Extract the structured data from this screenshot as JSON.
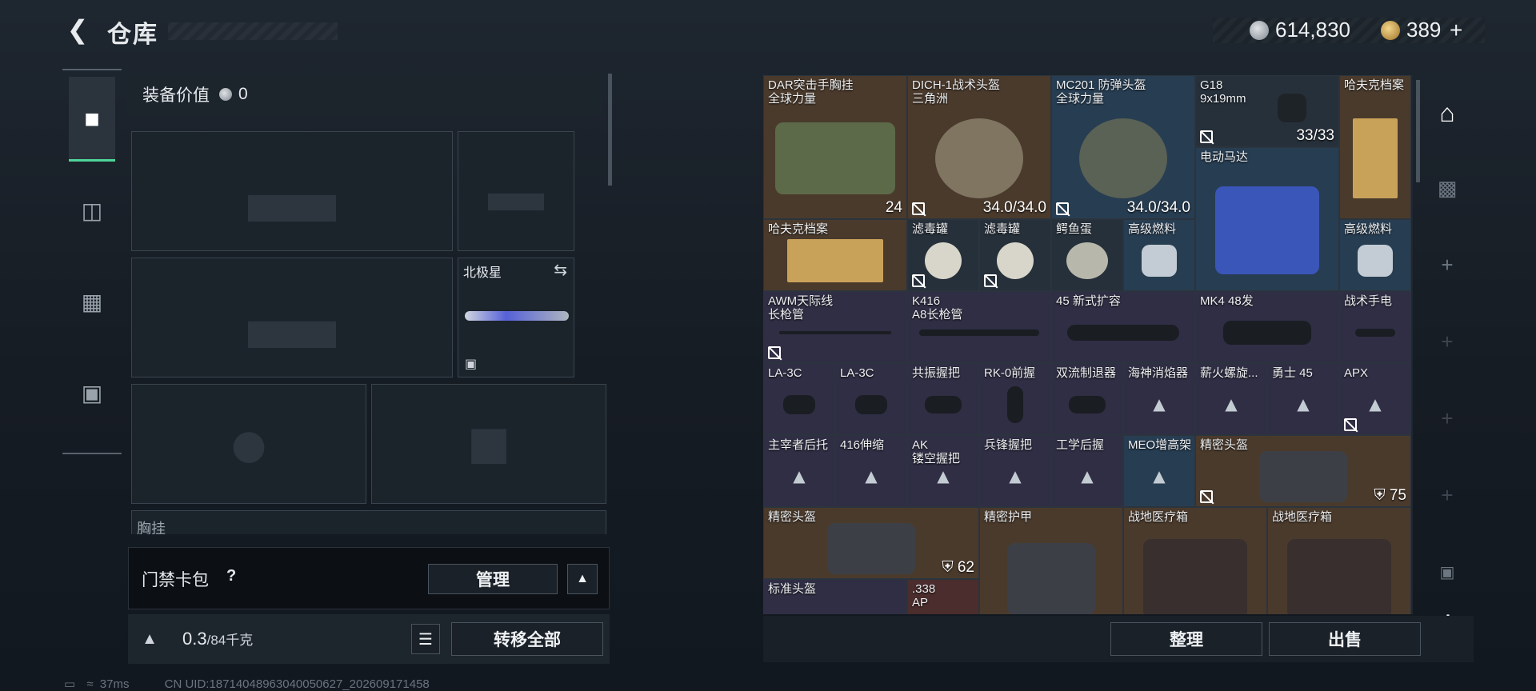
{
  "header": {
    "title": "仓库"
  },
  "currency": {
    "silver": "614,830",
    "gold": "389",
    "gold_plus": "+"
  },
  "tabs": [
    {
      "name": "weapons"
    },
    {
      "name": "backpack"
    },
    {
      "name": "chest-rig"
    },
    {
      "name": "case"
    }
  ],
  "loadout": {
    "value_label": "装备价值",
    "value": "0",
    "melee_name": "北极星",
    "chest_label": "胸挂"
  },
  "keycard": {
    "label": "门禁卡包",
    "help": "?",
    "manage": "管理"
  },
  "capacity": {
    "current": "0.3",
    "max": "/84千克",
    "transfer_all": "转移全部"
  },
  "status": {
    "ping": "37ms",
    "uid": "CN UID:18714048963040050627_202609171458"
  },
  "items": [
    {
      "name": "DAR突击手胸挂\n全球力量",
      "value": "24",
      "color": "brown"
    },
    {
      "name": "DICH-1战术头盔\n三角洲",
      "value": "34.0/34.0",
      "color": "brown"
    },
    {
      "name": "MC201 防弹头盔\n全球力量",
      "value": "34.0/34.0",
      "color": "blue"
    },
    {
      "name": "G18\n9x19mm",
      "value": "33/33",
      "color": "gray"
    },
    {
      "name": "哈夫克档案",
      "value": "",
      "color": "brown"
    },
    {
      "name": "电动马达",
      "value": "",
      "color": "blue"
    },
    {
      "name": "哈夫克档案",
      "value": "",
      "color": "brown"
    },
    {
      "name": "滤毒罐",
      "value": "",
      "color": "gray"
    },
    {
      "name": "滤毒罐",
      "value": "",
      "color": "gray"
    },
    {
      "name": "鳄鱼蛋",
      "value": "",
      "color": "gray"
    },
    {
      "name": "高级燃料",
      "value": "",
      "color": "blue"
    },
    {
      "name": "高级燃料",
      "value": "",
      "color": "blue"
    },
    {
      "name": "AWM天际线\n长枪管",
      "value": "",
      "color": "purple"
    },
    {
      "name": "K416\nA8长枪管",
      "value": "",
      "color": "purple"
    },
    {
      "name": "45 新式扩容",
      "value": "",
      "color": "purple"
    },
    {
      "name": "MK4 48发",
      "value": "",
      "color": "purple"
    },
    {
      "name": "战术手电",
      "value": "",
      "color": "purple"
    },
    {
      "name": "LA-3C",
      "value": "",
      "color": "purple"
    },
    {
      "name": "LA-3C",
      "value": "",
      "color": "purple"
    },
    {
      "name": "共振握把",
      "value": "",
      "color": "purple"
    },
    {
      "name": "RK-0前握",
      "value": "",
      "color": "purple"
    },
    {
      "name": "双流制退器",
      "value": "",
      "color": "purple"
    },
    {
      "name": "海神消焰器",
      "value": "",
      "color": "purple"
    },
    {
      "name": "薪火螺旋...",
      "value": "",
      "color": "purple"
    },
    {
      "name": "勇士 45",
      "value": "",
      "color": "purple"
    },
    {
      "name": "APX",
      "value": "",
      "color": "purple"
    },
    {
      "name": "主宰者后托",
      "value": "",
      "color": "purple"
    },
    {
      "name": "416伸缩",
      "value": "",
      "color": "purple"
    },
    {
      "name": "AK\n镂空握把",
      "value": "",
      "color": "purple"
    },
    {
      "name": "兵锋握把",
      "value": "",
      "color": "purple"
    },
    {
      "name": "工学后握",
      "value": "",
      "color": "purple"
    },
    {
      "name": "MEO增高架",
      "value": "",
      "color": "blue"
    },
    {
      "name": "精密头盔",
      "value": "75",
      "color": "brown"
    },
    {
      "name": "精密头盔",
      "value": "62",
      "color": "brown"
    },
    {
      "name": "精密护甲",
      "value": "",
      "color": "brown"
    },
    {
      "name": "战地医疗箱",
      "value": "",
      "color": "brown"
    },
    {
      "name": "战地医疗箱",
      "value": "",
      "color": "brown"
    },
    {
      "name": "标准头盔",
      "value": "",
      "color": "purple"
    },
    {
      "name": ".338\nAP",
      "value": "",
      "color": "red"
    }
  ],
  "actions": {
    "organize": "整理",
    "sell": "出售"
  }
}
